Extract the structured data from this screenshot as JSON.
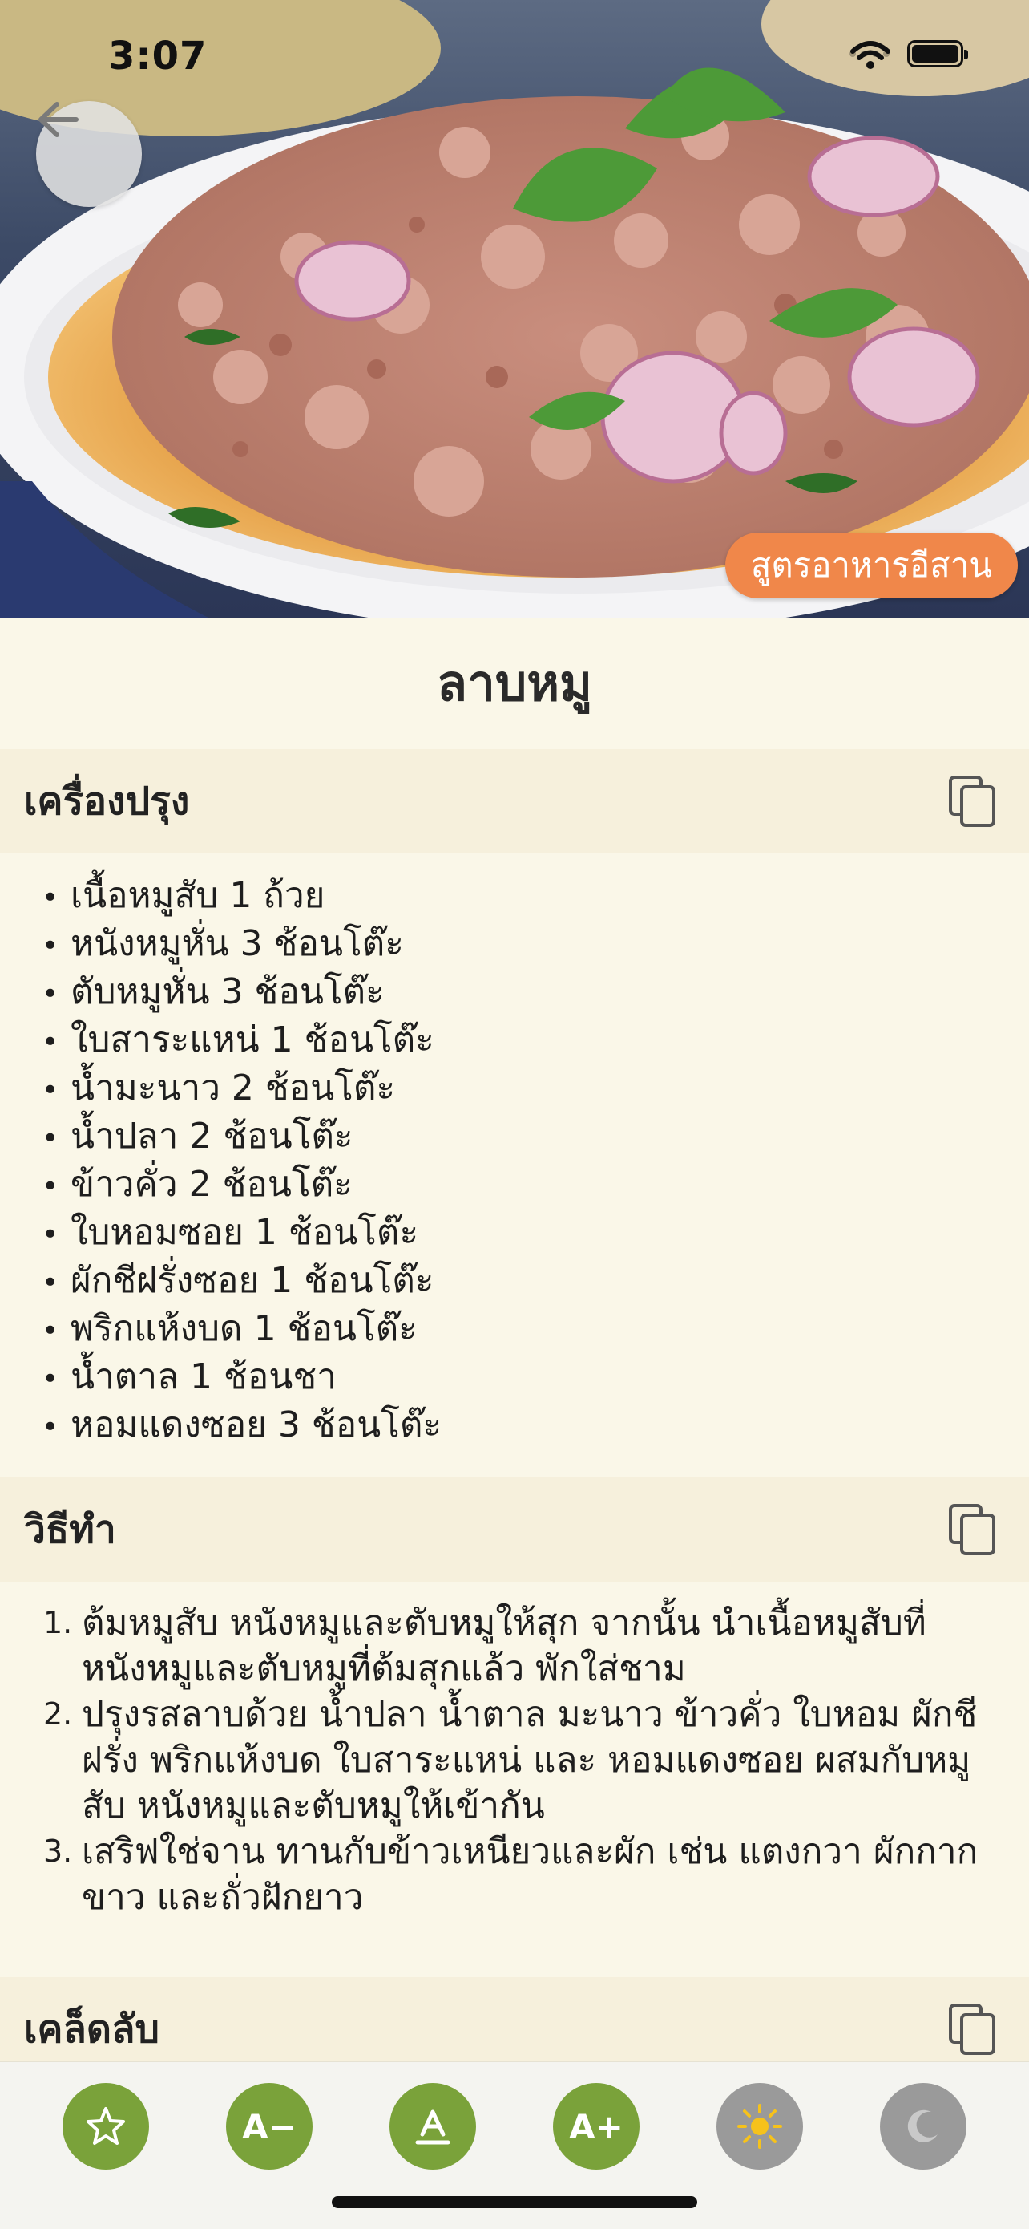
{
  "status_bar": {
    "time": "3:07"
  },
  "hero": {
    "category_chip": "สูตรอาหารอีสาน"
  },
  "recipe": {
    "title": "ลาบหมู",
    "ingredients_header": "เครื่องปรุง",
    "ingredients": [
      "เนื้อหมูสับ 1 ถ้วย",
      "หนังหมูหั่น 3 ช้อนโต๊ะ",
      "ตับหมูหั่น 3 ช้อนโต๊ะ",
      "ใบสาระแหน่ 1 ช้อนโต๊ะ",
      "น้ำมะนาว 2 ช้อนโต๊ะ",
      "น้ำปลา 2 ช้อนโต๊ะ",
      "ข้าวคั่ว 2 ช้อนโต๊ะ",
      "ใบหอมซอย 1 ช้อนโต๊ะ",
      "ผักชีฝรั่งซอย 1 ช้อนโต๊ะ",
      "พริกแห้งบด 1 ช้อนโต๊ะ",
      "น้ำตาล 1 ช้อนชา",
      "หอมแดงซอย 3 ช้อนโต๊ะ"
    ],
    "method_header": "วิธีทำ",
    "steps": [
      {
        "num": "1.",
        "lines": [
          "ต้มหมูสับ หนังหมูและตับหมูให้สุก จากนั้น นำเนื้อหมูสับที่",
          "หนังหมูและตับหมูที่ต้มสุกแล้ว พักใส่ชาม"
        ]
      },
      {
        "num": "2.",
        "lines": [
          "ปรุงรสลาบด้วย น้ำปลา น้ำตาล มะนาว ข้าวคั่ว ใบหอม ผักชี",
          "ฝรั่ง พริกแห้งบด ใบสาระแหน่ และ หอมแดงซอย ผสมกับหมู",
          "สับ หนังหมูและตับหมูให้เข้ากัน"
        ]
      },
      {
        "num": "3.",
        "lines": [
          "เสริฟใช่จาน ทานกับข้าวเหนียวและผัก เช่น แตงกวา ผักกาก",
          "ขาว และถั่วฝักยาว"
        ]
      }
    ],
    "tips_header": "เคล็ดลับ"
  },
  "toolbar": {
    "decrease_font_label": "A−",
    "increase_font_label": "A+",
    "icons": [
      "star-icon",
      "font-decrease-icon",
      "font-reset-icon",
      "font-increase-icon",
      "sun-icon",
      "moon-icon"
    ]
  },
  "colors": {
    "accent_green": "#7aa23a",
    "chip_orange": "#f0874a",
    "page_background": "#faf7e8",
    "section_header_background": "#f6f0dc",
    "gray_button": "#9a9a9a"
  }
}
